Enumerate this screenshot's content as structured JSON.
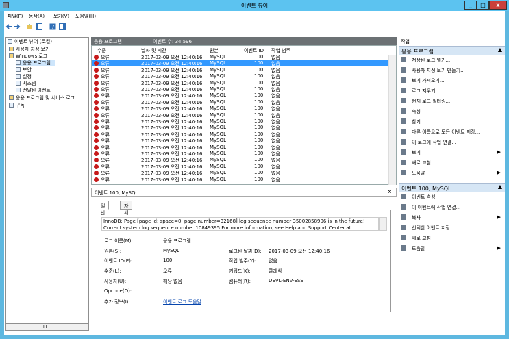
{
  "window": {
    "title": "이벤트 뷰어",
    "min": "_",
    "max": "□",
    "close": "x"
  },
  "menu": [
    "파일(F)",
    "동작(A)",
    "보기(V)",
    "도움말(H)"
  ],
  "tree": [
    {
      "label": "이벤트 뷰어 (로컬)",
      "indent": 0
    },
    {
      "label": "사용자 지정 보기",
      "indent": 1
    },
    {
      "label": "Windows 로그",
      "indent": 1
    },
    {
      "label": "응용 프로그램",
      "indent": 2
    },
    {
      "label": "보안",
      "indent": 2
    },
    {
      "label": "설정",
      "indent": 2
    },
    {
      "label": "시스템",
      "indent": 2
    },
    {
      "label": "전달된 이벤트",
      "indent": 2
    },
    {
      "label": "응용 프로그램 및 서비스 로그",
      "indent": 1
    },
    {
      "label": "구독",
      "indent": 1
    }
  ],
  "center": {
    "header_log": "응용 프로그램",
    "header_count": "이벤트 수: 34,596",
    "columns": [
      "수준",
      "날짜 및 시간",
      "원본",
      "이벤트 ID",
      "작업 범주"
    ],
    "rows": [
      [
        "오류",
        "2017-03-09 오전 12:40:16",
        "MySQL",
        "100",
        "없음"
      ],
      [
        "오류",
        "2017-03-09 오전 12:40:16",
        "MySQL",
        "100",
        "없음"
      ],
      [
        "오류",
        "2017-03-09 오전 12:40:16",
        "MySQL",
        "100",
        "없음"
      ],
      [
        "오류",
        "2017-03-09 오전 12:40:16",
        "MySQL",
        "100",
        "없음"
      ],
      [
        "오류",
        "2017-03-09 오전 12:40:16",
        "MySQL",
        "100",
        "없음"
      ],
      [
        "오류",
        "2017-03-09 오전 12:40:16",
        "MySQL",
        "100",
        "없음"
      ],
      [
        "오류",
        "2017-03-09 오전 12:40:16",
        "MySQL",
        "100",
        "없음"
      ],
      [
        "오류",
        "2017-03-09 오전 12:40:16",
        "MySQL",
        "100",
        "없음"
      ],
      [
        "오류",
        "2017-03-09 오전 12:40:16",
        "MySQL",
        "100",
        "없음"
      ],
      [
        "오류",
        "2017-03-09 오전 12:40:16",
        "MySQL",
        "100",
        "없음"
      ],
      [
        "오류",
        "2017-03-09 오전 12:40:16",
        "MySQL",
        "100",
        "없음"
      ],
      [
        "오류",
        "2017-03-09 오전 12:40:16",
        "MySQL",
        "100",
        "없음"
      ],
      [
        "오류",
        "2017-03-09 오전 12:40:16",
        "MySQL",
        "100",
        "없음"
      ],
      [
        "오류",
        "2017-03-09 오전 12:40:16",
        "MySQL",
        "100",
        "없음"
      ],
      [
        "오류",
        "2017-03-09 오전 12:40:16",
        "MySQL",
        "100",
        "없음"
      ],
      [
        "오류",
        "2017-03-09 오전 12:40:16",
        "MySQL",
        "100",
        "없음"
      ],
      [
        "오류",
        "2017-03-09 오전 12:40:16",
        "MySQL",
        "100",
        "없음"
      ],
      [
        "오류",
        "2017-03-09 오전 12:40:16",
        "MySQL",
        "100",
        "없음"
      ],
      [
        "오류",
        "2017-03-09 오전 12:40:16",
        "MySQL",
        "100",
        "없음"
      ],
      [
        "오류",
        "2017-03-09 오전 12:40:16",
        "MySQL",
        "100",
        "없음"
      ]
    ],
    "selected_row": 1
  },
  "detail": {
    "title": "이벤트 100, MySQL",
    "close": "×",
    "tabs": [
      "일반",
      "자세히"
    ],
    "description": "InnoDB: Page [page id: space=0, page number=32168] log sequence number 35002858906 is in the future! Current system log sequence number 10849395.For more information, see Help and Support Center at",
    "labels": {
      "log": "로그 이름(M):",
      "source": "원본(S):",
      "logged": "로그된 날짜(D):",
      "eventid": "이벤트 ID(E):",
      "category": "작업 범주(Y):",
      "level": "수준(L):",
      "keywords": "키워드(K):",
      "user": "사용자(U):",
      "computer": "컴퓨터(R):",
      "opcode": "Opcode(O):",
      "more": "추가 정보(I):"
    },
    "values": {
      "log": "응용 프로그램",
      "source": "MySQL",
      "logged": "2017-03-09 오전 12:40:16",
      "eventid": "100",
      "category": "없음",
      "level": "오류",
      "keywords": "클래식",
      "user": "해당 없음",
      "computer": "DEVL-ENV-ESS",
      "more": "이벤트 로그 도움말"
    }
  },
  "actions": {
    "top": "작업",
    "section1": "응용 프로그램",
    "items1": [
      "저장된 로그 열기...",
      "사용자 지정 보기 만들기...",
      "보기 가져오기...",
      "로그 지우기...",
      "현재 로그 필터링...",
      "속성",
      "찾기...",
      "다른 이름으로 모든 이벤트 저장...",
      "이 로그에 작업 연결...",
      "보기",
      "새로 고침",
      "도움말"
    ],
    "section2": "이벤트 100, MySQL",
    "items2": [
      "이벤트 속성",
      "이 이벤트에 작업 연결...",
      "복사",
      "선택한 이벤트 저장...",
      "새로 고침",
      "도움말"
    ]
  },
  "hscroll": "III"
}
